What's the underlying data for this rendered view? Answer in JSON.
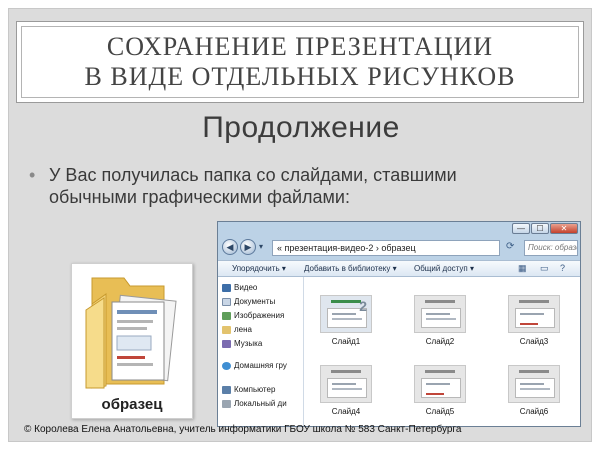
{
  "slide": {
    "title_lines": [
      "Сохранение презентации",
      "в виде отдельных рисунков"
    ],
    "subtitle": "Продолжение",
    "bullet_line1": "У Вас получилась папка со слайдами, ставшими",
    "bullet_line2": "обычными графическими файлами:"
  },
  "folder": {
    "label": "образец",
    "icon": "folder-icon"
  },
  "explorer": {
    "address": "« презентация-видео-2 › образец",
    "search_placeholder": "Поиск: образец",
    "window_buttons": [
      "—",
      "☐",
      "✕"
    ],
    "toolbar": {
      "organize": "Упорядочить ▾",
      "add_to_library": "Добавить в библиотеку ▾",
      "share": "Общий доступ ▾"
    },
    "sidebar": {
      "items": [
        "Видео",
        "Документы",
        "Изображения",
        "лена",
        "Музыка"
      ],
      "homegroup": "Домашняя гру",
      "computer": "Компьютер",
      "local_disk": "Локальный ди"
    },
    "thumbnails": [
      "Слайд1",
      "Слайд2",
      "Слайд3",
      "Слайд4",
      "Слайд5",
      "Слайд6"
    ]
  },
  "footer": "© Королева Елена Анатольевна, учитель информатики ГБОУ школа № 583 Санкт-Петербурга",
  "colors": {
    "slide_bg": "#dcdcdc",
    "title_text": "#444444",
    "explorer_frame": "#bcd2e6",
    "folder_yellow": "#f3d37a"
  }
}
